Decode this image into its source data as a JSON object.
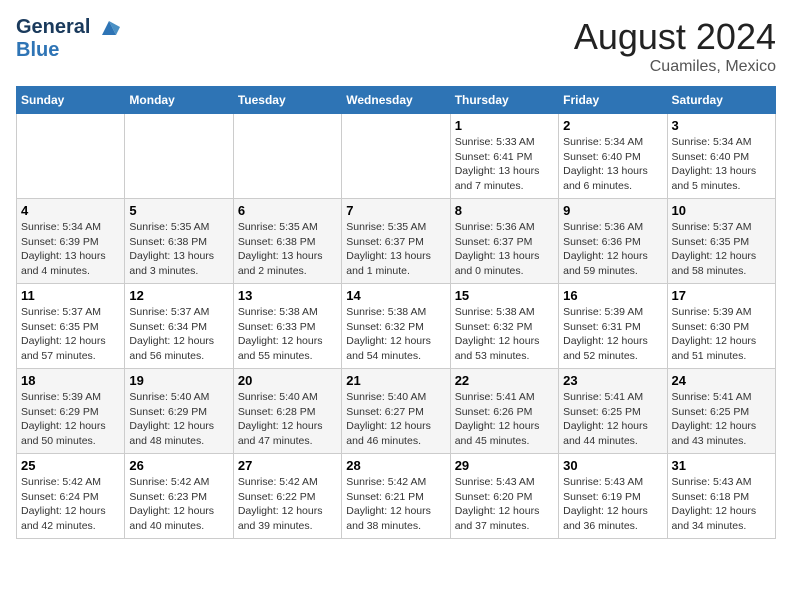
{
  "logo": {
    "line1": "General",
    "line2": "Blue"
  },
  "title": "August 2024",
  "subtitle": "Cuamiles, Mexico",
  "headers": [
    "Sunday",
    "Monday",
    "Tuesday",
    "Wednesday",
    "Thursday",
    "Friday",
    "Saturday"
  ],
  "weeks": [
    [
      {
        "day": "",
        "info": ""
      },
      {
        "day": "",
        "info": ""
      },
      {
        "day": "",
        "info": ""
      },
      {
        "day": "",
        "info": ""
      },
      {
        "day": "1",
        "info": "Sunrise: 5:33 AM\nSunset: 6:41 PM\nDaylight: 13 hours\nand 7 minutes."
      },
      {
        "day": "2",
        "info": "Sunrise: 5:34 AM\nSunset: 6:40 PM\nDaylight: 13 hours\nand 6 minutes."
      },
      {
        "day": "3",
        "info": "Sunrise: 5:34 AM\nSunset: 6:40 PM\nDaylight: 13 hours\nand 5 minutes."
      }
    ],
    [
      {
        "day": "4",
        "info": "Sunrise: 5:34 AM\nSunset: 6:39 PM\nDaylight: 13 hours\nand 4 minutes."
      },
      {
        "day": "5",
        "info": "Sunrise: 5:35 AM\nSunset: 6:38 PM\nDaylight: 13 hours\nand 3 minutes."
      },
      {
        "day": "6",
        "info": "Sunrise: 5:35 AM\nSunset: 6:38 PM\nDaylight: 13 hours\nand 2 minutes."
      },
      {
        "day": "7",
        "info": "Sunrise: 5:35 AM\nSunset: 6:37 PM\nDaylight: 13 hours\nand 1 minute."
      },
      {
        "day": "8",
        "info": "Sunrise: 5:36 AM\nSunset: 6:37 PM\nDaylight: 13 hours\nand 0 minutes."
      },
      {
        "day": "9",
        "info": "Sunrise: 5:36 AM\nSunset: 6:36 PM\nDaylight: 12 hours\nand 59 minutes."
      },
      {
        "day": "10",
        "info": "Sunrise: 5:37 AM\nSunset: 6:35 PM\nDaylight: 12 hours\nand 58 minutes."
      }
    ],
    [
      {
        "day": "11",
        "info": "Sunrise: 5:37 AM\nSunset: 6:35 PM\nDaylight: 12 hours\nand 57 minutes."
      },
      {
        "day": "12",
        "info": "Sunrise: 5:37 AM\nSunset: 6:34 PM\nDaylight: 12 hours\nand 56 minutes."
      },
      {
        "day": "13",
        "info": "Sunrise: 5:38 AM\nSunset: 6:33 PM\nDaylight: 12 hours\nand 55 minutes."
      },
      {
        "day": "14",
        "info": "Sunrise: 5:38 AM\nSunset: 6:32 PM\nDaylight: 12 hours\nand 54 minutes."
      },
      {
        "day": "15",
        "info": "Sunrise: 5:38 AM\nSunset: 6:32 PM\nDaylight: 12 hours\nand 53 minutes."
      },
      {
        "day": "16",
        "info": "Sunrise: 5:39 AM\nSunset: 6:31 PM\nDaylight: 12 hours\nand 52 minutes."
      },
      {
        "day": "17",
        "info": "Sunrise: 5:39 AM\nSunset: 6:30 PM\nDaylight: 12 hours\nand 51 minutes."
      }
    ],
    [
      {
        "day": "18",
        "info": "Sunrise: 5:39 AM\nSunset: 6:29 PM\nDaylight: 12 hours\nand 50 minutes."
      },
      {
        "day": "19",
        "info": "Sunrise: 5:40 AM\nSunset: 6:29 PM\nDaylight: 12 hours\nand 48 minutes."
      },
      {
        "day": "20",
        "info": "Sunrise: 5:40 AM\nSunset: 6:28 PM\nDaylight: 12 hours\nand 47 minutes."
      },
      {
        "day": "21",
        "info": "Sunrise: 5:40 AM\nSunset: 6:27 PM\nDaylight: 12 hours\nand 46 minutes."
      },
      {
        "day": "22",
        "info": "Sunrise: 5:41 AM\nSunset: 6:26 PM\nDaylight: 12 hours\nand 45 minutes."
      },
      {
        "day": "23",
        "info": "Sunrise: 5:41 AM\nSunset: 6:25 PM\nDaylight: 12 hours\nand 44 minutes."
      },
      {
        "day": "24",
        "info": "Sunrise: 5:41 AM\nSunset: 6:25 PM\nDaylight: 12 hours\nand 43 minutes."
      }
    ],
    [
      {
        "day": "25",
        "info": "Sunrise: 5:42 AM\nSunset: 6:24 PM\nDaylight: 12 hours\nand 42 minutes."
      },
      {
        "day": "26",
        "info": "Sunrise: 5:42 AM\nSunset: 6:23 PM\nDaylight: 12 hours\nand 40 minutes."
      },
      {
        "day": "27",
        "info": "Sunrise: 5:42 AM\nSunset: 6:22 PM\nDaylight: 12 hours\nand 39 minutes."
      },
      {
        "day": "28",
        "info": "Sunrise: 5:42 AM\nSunset: 6:21 PM\nDaylight: 12 hours\nand 38 minutes."
      },
      {
        "day": "29",
        "info": "Sunrise: 5:43 AM\nSunset: 6:20 PM\nDaylight: 12 hours\nand 37 minutes."
      },
      {
        "day": "30",
        "info": "Sunrise: 5:43 AM\nSunset: 6:19 PM\nDaylight: 12 hours\nand 36 minutes."
      },
      {
        "day": "31",
        "info": "Sunrise: 5:43 AM\nSunset: 6:18 PM\nDaylight: 12 hours\nand 34 minutes."
      }
    ]
  ]
}
